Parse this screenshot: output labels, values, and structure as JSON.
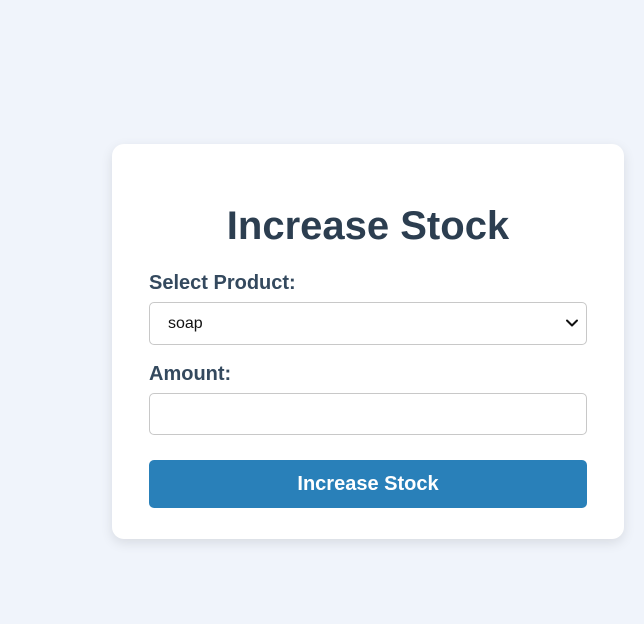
{
  "form": {
    "title": "Increase Stock",
    "product_label": "Select Product:",
    "product_selected": "soap",
    "amount_label": "Amount:",
    "amount_value": "",
    "submit_label": "Increase Stock"
  },
  "colors": {
    "background": "#f0f4fb",
    "card": "#ffffff",
    "title": "#2c3e50",
    "label": "#34495e",
    "button": "#2980b9",
    "button_text": "#ffffff"
  },
  "icons": {
    "select_arrow": "chevron-down-icon"
  }
}
